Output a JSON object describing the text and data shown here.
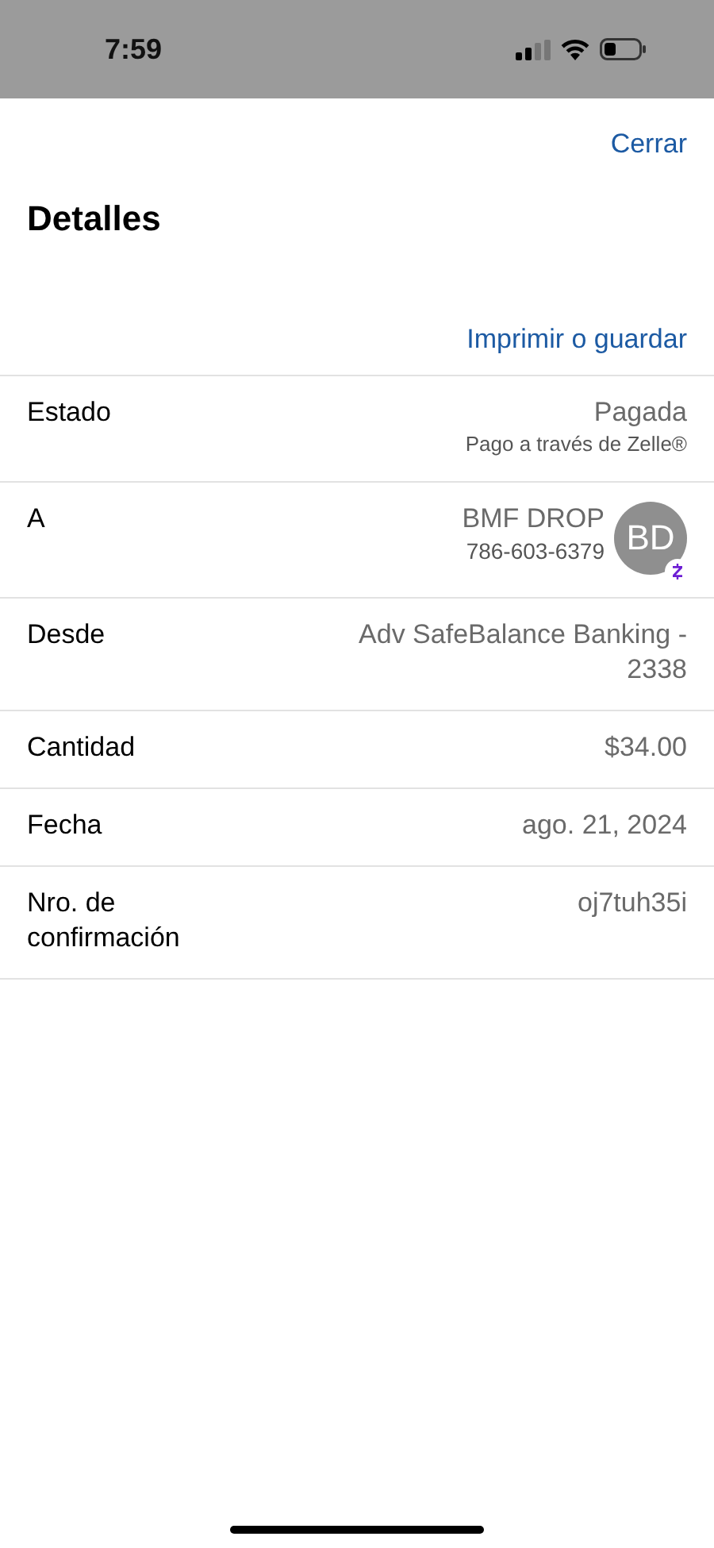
{
  "status_bar": {
    "time": "7:59"
  },
  "close_link": "Cerrar",
  "title": "Detalles",
  "print_link": "Imprimir o guardar",
  "rows": [
    {
      "kind": "text",
      "label": "Estado",
      "value": "Pagada",
      "note": "Pago a través de Zelle®"
    },
    {
      "kind": "contact",
      "label": "A",
      "value": "BMF DROP",
      "note": "786-603-6379",
      "avatar": "BD"
    },
    {
      "kind": "text",
      "label": "Desde",
      "value": "Adv SafeBalance Banking - 2338"
    },
    {
      "kind": "text",
      "label": "Cantidad",
      "value": "$34.00"
    },
    {
      "kind": "text",
      "label": "Fecha",
      "value": "ago. 21, 2024"
    },
    {
      "kind": "text",
      "label": "Nro. de confirmación",
      "value": "oj7tuh35i"
    }
  ]
}
